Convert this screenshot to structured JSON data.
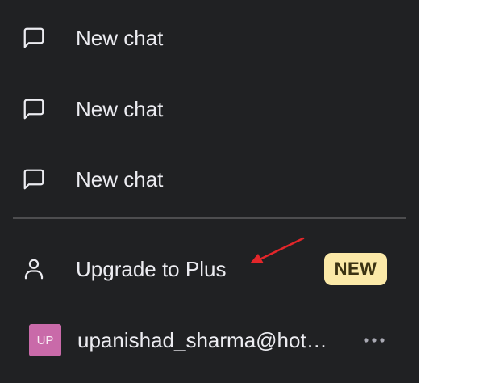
{
  "sidebar": {
    "chat_items": [
      {
        "label": "New chat",
        "icon": "message-square-icon"
      },
      {
        "label": "New chat",
        "icon": "message-square-icon"
      },
      {
        "label": "New chat",
        "icon": "message-square-icon"
      }
    ],
    "upgrade": {
      "label": "Upgrade to Plus",
      "icon": "user-icon",
      "badge": "NEW"
    },
    "user": {
      "avatar_initials": "UP",
      "email": "upanishad_sharma@hotmail.com",
      "more_icon": "ellipsis-icon"
    }
  },
  "colors": {
    "sidebar_bg": "#202123",
    "text": "#ececf1",
    "divider": "#4d4d4f",
    "badge_bg": "#fbe9a8",
    "avatar_bg": "#c96aa9",
    "annotation_arrow": "#e3262a"
  }
}
